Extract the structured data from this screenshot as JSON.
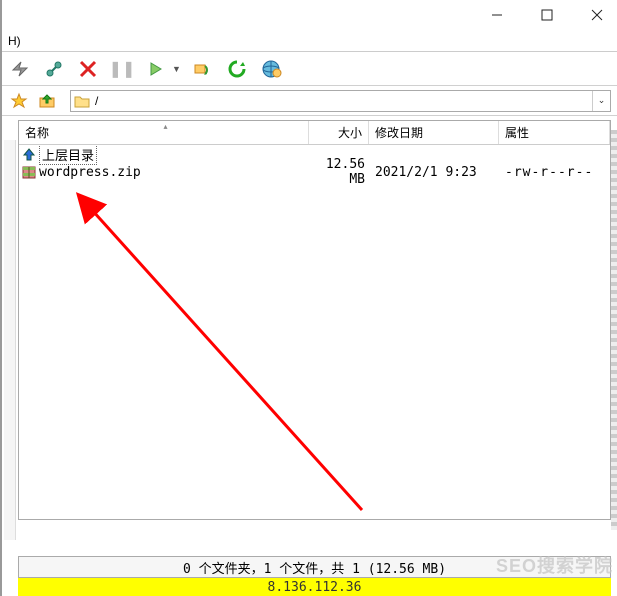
{
  "titlebar": {
    "min": "—",
    "max": "☐",
    "close": "✕"
  },
  "menubar": {
    "item0": "H)"
  },
  "toolbar": {
    "lightning": "lightning",
    "connect": "connect",
    "cancel": "✕",
    "pause": "❚❚",
    "play": "▶",
    "sync": "sync",
    "refresh": "refresh",
    "globe": "globe"
  },
  "pathbar": {
    "star": "★",
    "up": "up",
    "path": "/"
  },
  "columns": {
    "name": "名称",
    "size": "大小",
    "date": "修改日期",
    "attr": "属性"
  },
  "parent": {
    "label": "上层目录"
  },
  "files": [
    {
      "name": "wordpress.zip",
      "size": "12.56 MB",
      "date": "2021/2/1 9:23",
      "attr": "-rw-r--r--"
    }
  ],
  "status": {
    "summary": "0 个文件夹，1 个文件，共 1 (12.56 MB)"
  },
  "ip": {
    "addr": "8.136.112.36"
  },
  "watermark": "SEO搜索学院"
}
